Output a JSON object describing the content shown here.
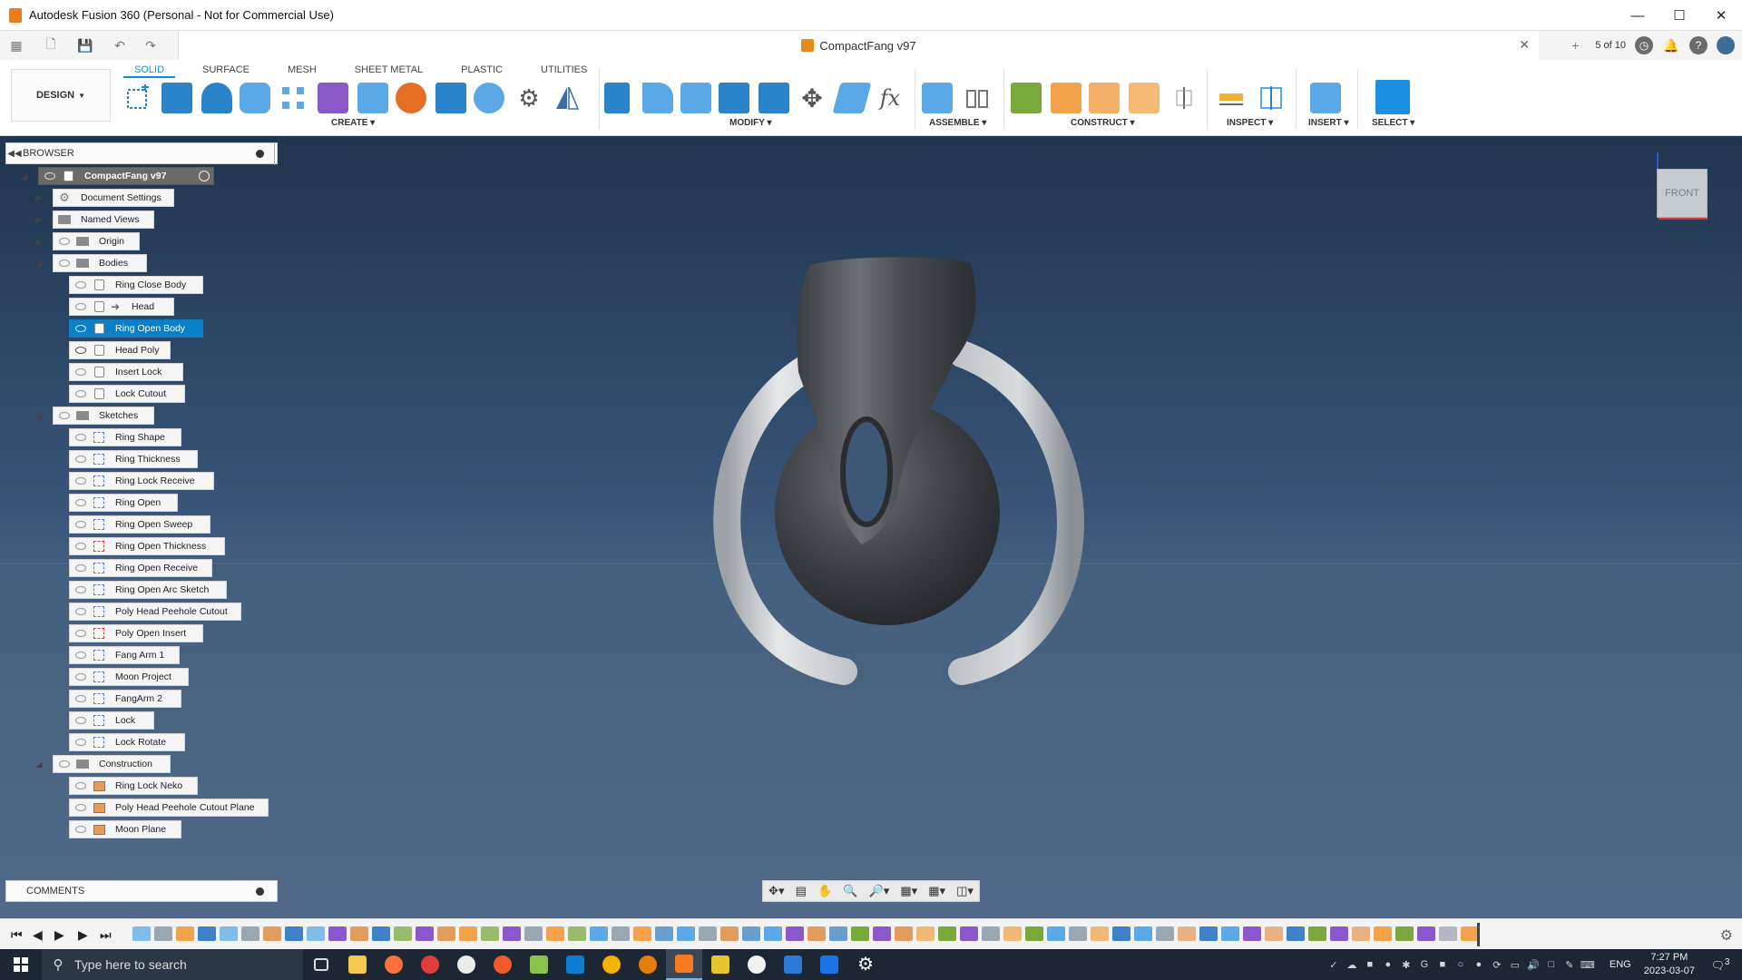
{
  "window": {
    "title": "Autodesk Fusion 360 (Personal - Not for Commercial Use)",
    "controls": [
      "minimize",
      "maximize",
      "close"
    ]
  },
  "document": {
    "tab_name": "CompactFang v97",
    "version_counter": "5 of 10"
  },
  "toolbar": {
    "workspace": "DESIGN",
    "tabs": [
      "SOLID",
      "SURFACE",
      "MESH",
      "SHEET METAL",
      "PLASTIC",
      "UTILITIES"
    ],
    "active_tab": "SOLID",
    "groups": {
      "create": "CREATE",
      "modify": "MODIFY",
      "assemble": "ASSEMBLE",
      "construct": "CONSTRUCT",
      "inspect": "INSPECT",
      "insert": "INSERT",
      "select": "SELECT"
    }
  },
  "browser": {
    "title": "BROWSER",
    "root": "CompactFang v97",
    "folders": {
      "document_settings": "Document Settings",
      "named_views": "Named Views",
      "origin": "Origin",
      "bodies": "Bodies",
      "sketches": "Sketches",
      "construction": "Construction"
    },
    "bodies": [
      "Ring Close Body",
      "Head",
      "Ring Open Body",
      "Head Poly",
      "Insert Lock",
      "Lock Cutout"
    ],
    "selected_body": "Ring Open Body",
    "sketches": [
      "Ring Shape",
      "Ring Thickness",
      "Ring Lock Receive",
      "Ring Open",
      "Ring Open Sweep",
      "Ring Open Thickness",
      "Ring Open Receive",
      "Ring Open Arc Sketch",
      "Poly Head Peehole Cutout",
      "Poly Open Insert",
      "Fang Arm 1",
      "Moon Project",
      "FangArm 2",
      "Lock",
      "Lock Rotate"
    ],
    "construction": [
      "Ring Lock Neko",
      "Poly Head Peehole Cutout Plane",
      "Moon Plane"
    ]
  },
  "comments": {
    "title": "COMMENTS"
  },
  "viewcube": {
    "face": "FRONT"
  },
  "taskbar": {
    "search_placeholder": "Type here to search",
    "language": "ENG",
    "time": "7:27 PM",
    "date": "2023-03-07",
    "notification_count": "3"
  },
  "colors": {
    "accent": "#0696d7",
    "selection": "#0b80c8",
    "viewport_top": "#21354f",
    "viewport_bottom": "#50698a",
    "taskbar": "#1c2733"
  }
}
